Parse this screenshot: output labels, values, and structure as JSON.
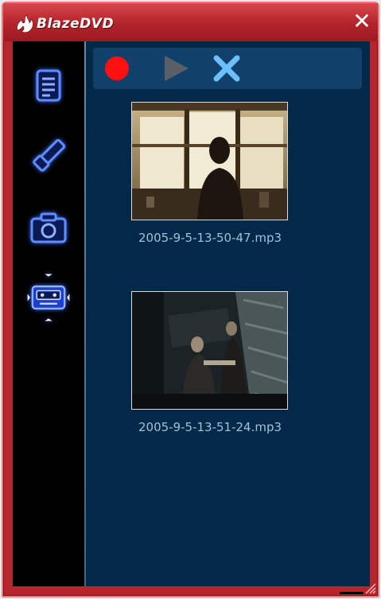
{
  "window": {
    "brand": "BlazeDVD",
    "close_glyph": "✕"
  },
  "sidebar": {
    "items": [
      {
        "icon": "playlist-icon"
      },
      {
        "icon": "bookmark-icon"
      },
      {
        "icon": "camera-icon"
      },
      {
        "icon": "audio-capture-icon",
        "selected": true
      }
    ]
  },
  "toolbar": {
    "record_icon": "record-icon",
    "play_icon": "play-icon",
    "delete_icon": "delete-icon"
  },
  "clips": [
    {
      "filename": "2005-9-5-13-50-47.mp3",
      "thumbnail": "window-silhouette-scene"
    },
    {
      "filename": "2005-9-5-13-51-24.mp3",
      "thumbnail": "dark-stone-wall-scene"
    }
  ],
  "colors": {
    "frame": "#b5252c",
    "panel": "#032848",
    "toolbar": "#11416b",
    "caption_text": "#9ec1dd",
    "icon_glow": "#4d7dff",
    "record": "#ff1010"
  }
}
